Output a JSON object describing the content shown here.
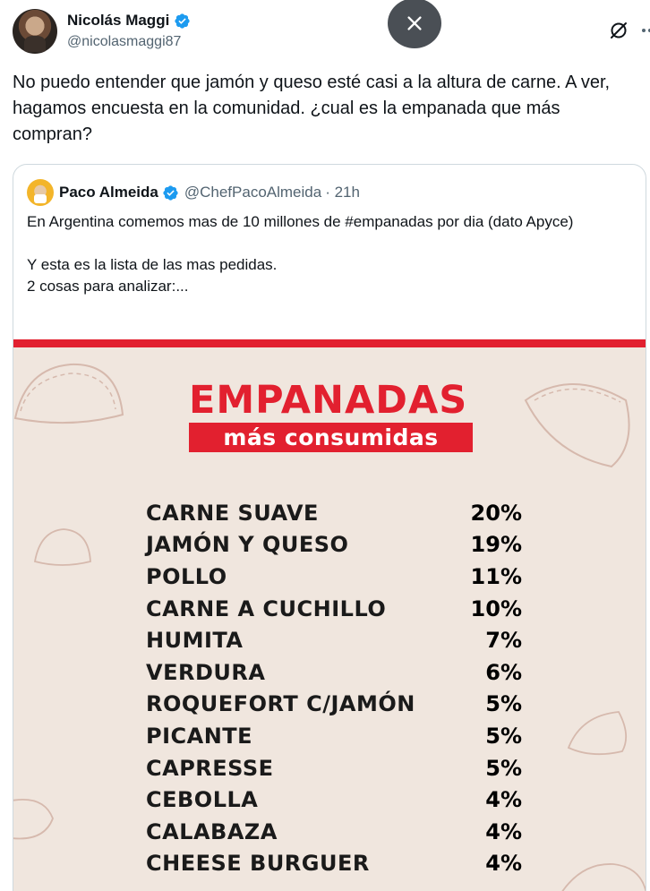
{
  "tweet": {
    "author": {
      "name": "Nicolás Maggi",
      "handle": "@nicolasmaggi87"
    },
    "text": "No puedo entender que jamón y queso esté casi a la altura de carne. A ver, hagamos encuesta en la comunidad. ¿cual es la empanada que más compran?"
  },
  "icons": {
    "verified": "verified-badge-icon",
    "close": "close-icon",
    "grok": "grok-icon",
    "more": "more-icon"
  },
  "quote": {
    "author": {
      "name": "Paco Almeida",
      "handle": "@ChefPacoAlmeida",
      "time": "· 21h"
    },
    "text_lines": [
      "En Argentina comemos mas de 10 millones de #empanadas por dia (dato Apyce)",
      "",
      "Y esta es la lista de las mas pedidas.",
      "2 cosas para analizar:..."
    ],
    "poster": {
      "title": "EMPANADAS",
      "subtitle": "más consumidas",
      "items": [
        {
          "name": "CARNE SUAVE",
          "pct": "20%"
        },
        {
          "name": "JAMÓN Y QUESO",
          "pct": "19%"
        },
        {
          "name": "POLLO",
          "pct": "11%"
        },
        {
          "name": "CARNE A CUCHILLO",
          "pct": "10%"
        },
        {
          "name": "HUMITA",
          "pct": "7%"
        },
        {
          "name": "VERDURA",
          "pct": "6%"
        },
        {
          "name": "ROQUEFORT C/JAMÓN",
          "pct": "5%"
        },
        {
          "name": "PICANTE",
          "pct": "5%"
        },
        {
          "name": "CAPRESSE",
          "pct": "5%"
        },
        {
          "name": "CEBOLLA",
          "pct": "4%"
        },
        {
          "name": "CALABAZA",
          "pct": "4%"
        },
        {
          "name": "CHEESE BURGUER",
          "pct": "4%"
        }
      ]
    }
  },
  "colors": {
    "accent_red": "#e2202f",
    "poster_bg": "#f0e6de",
    "verified_blue": "#1d9bf0",
    "muted": "#536471"
  }
}
